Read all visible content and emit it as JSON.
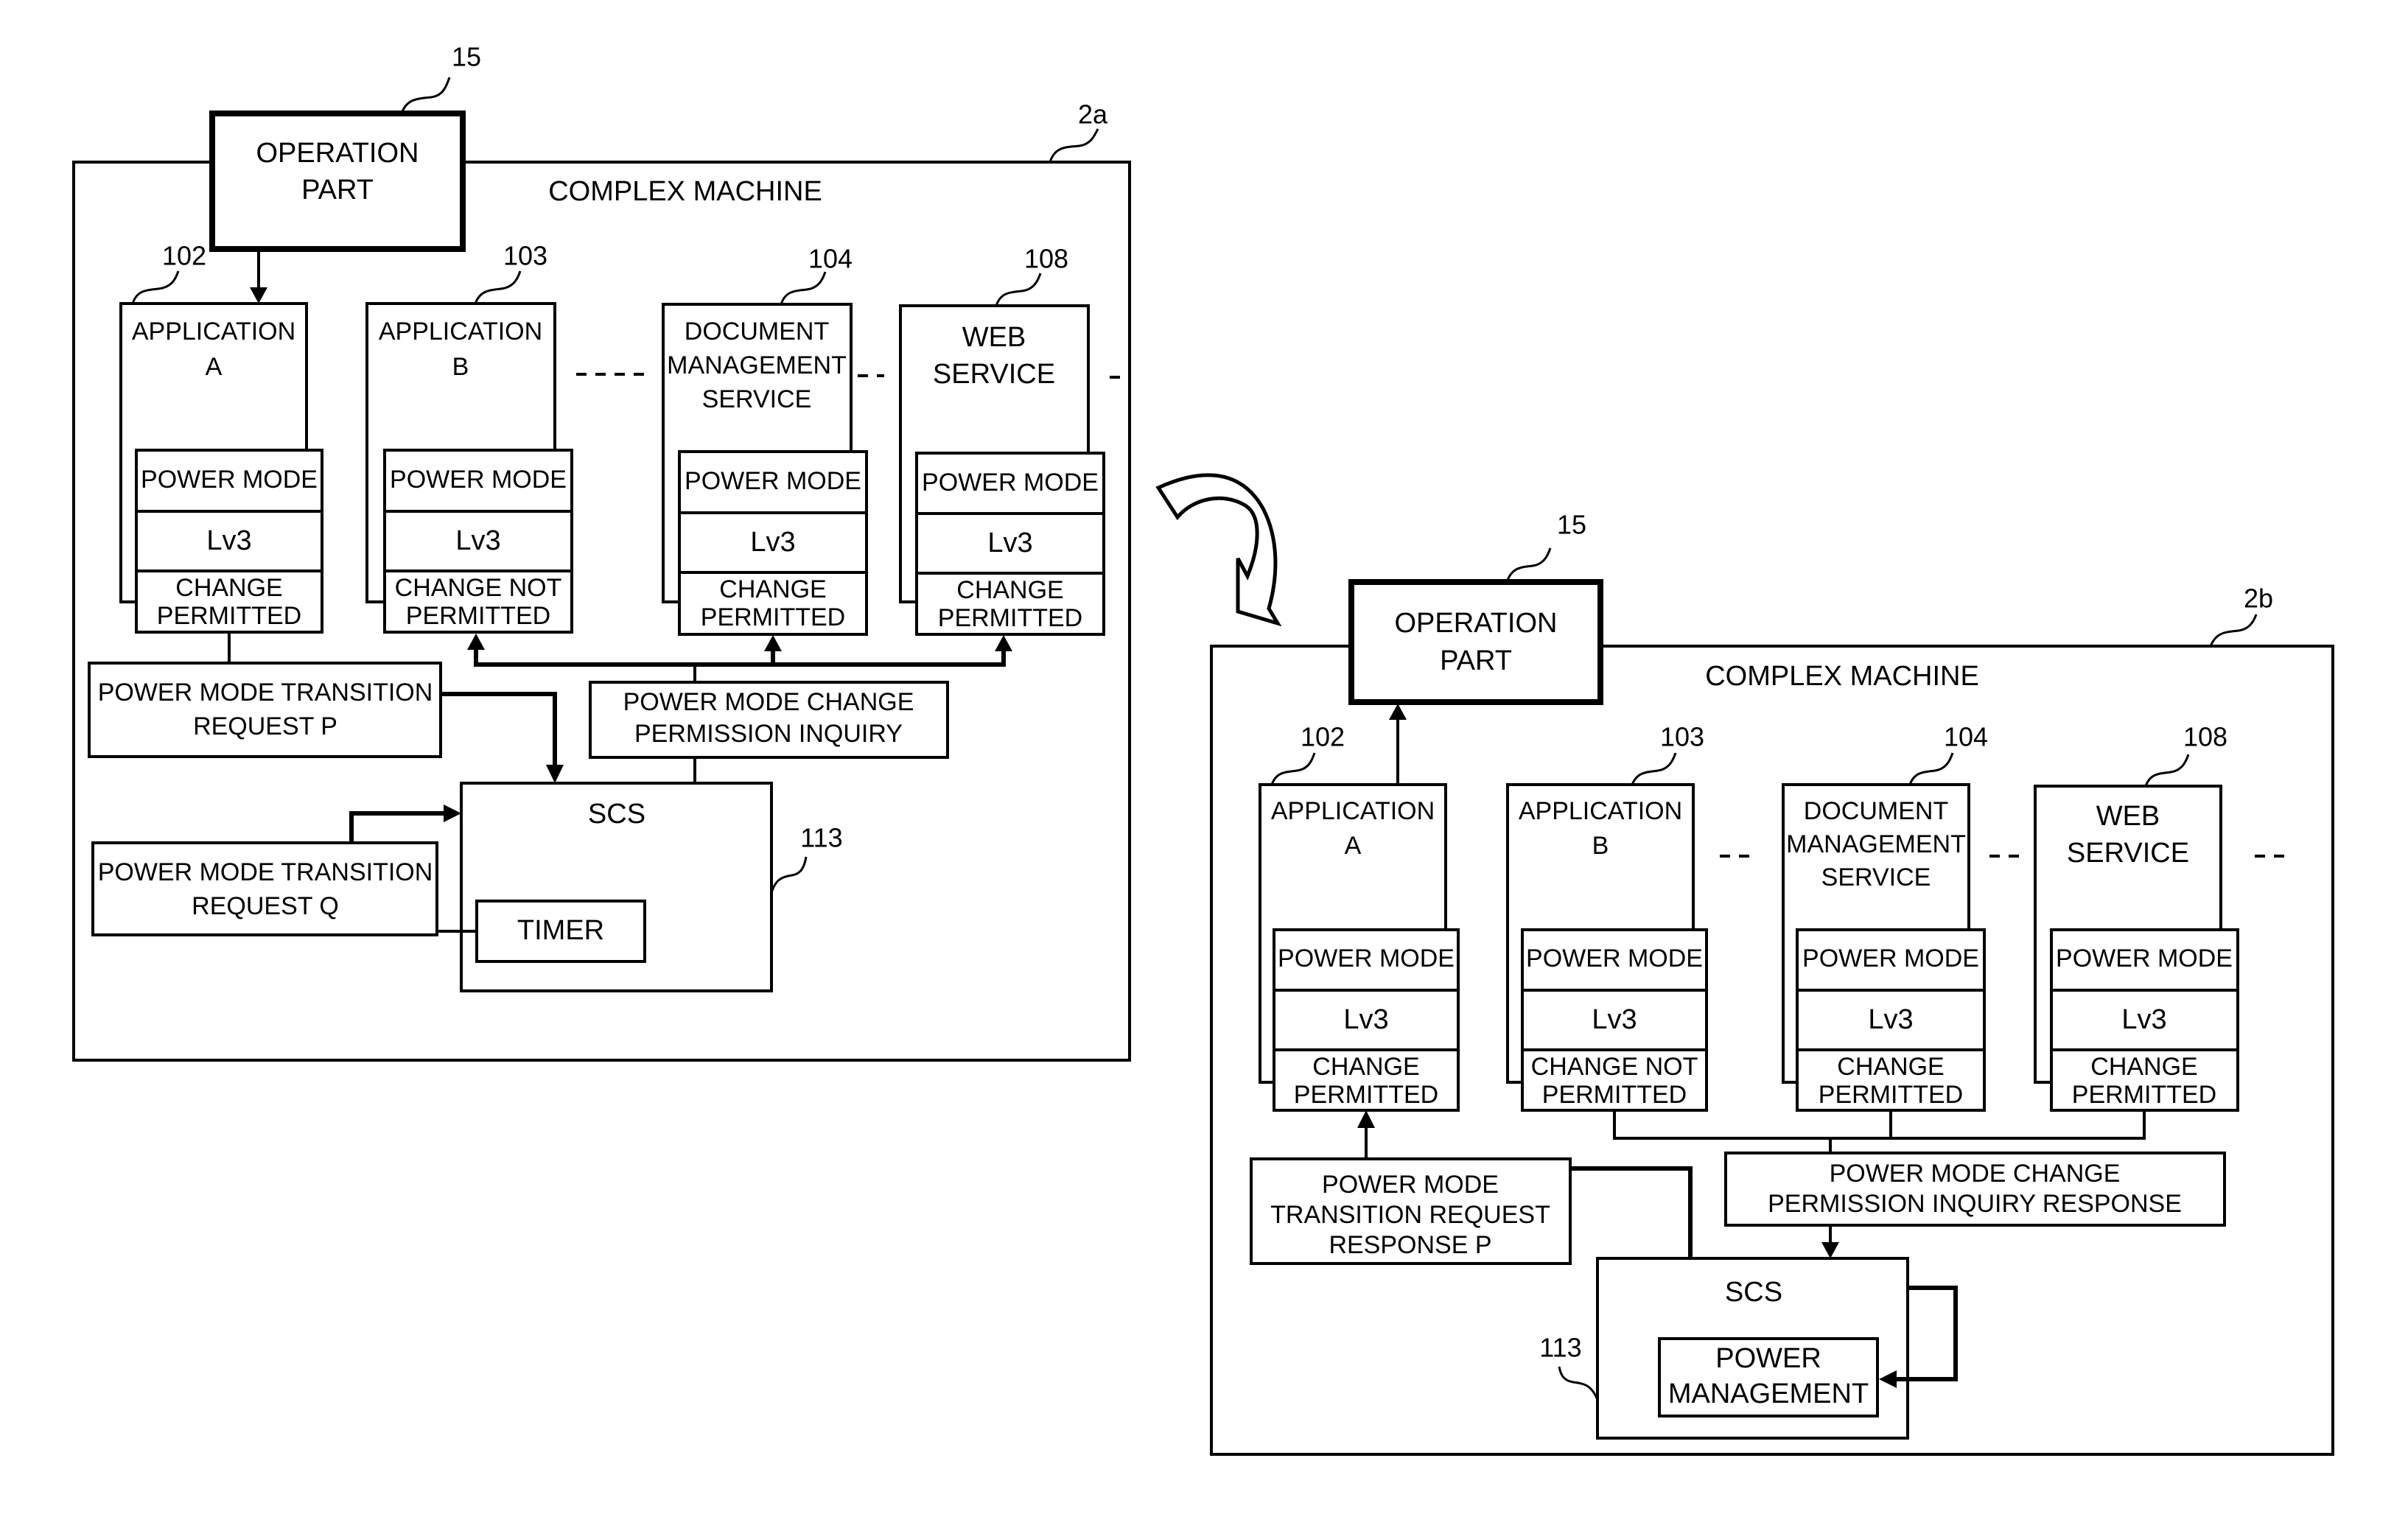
{
  "panel_a": {
    "ref_machine": "2a",
    "machine_label": "COMPLEX MACHINE",
    "operation_part": {
      "ref": "15",
      "line1": "OPERATION",
      "line2": "PART"
    },
    "modules": [
      {
        "ref": "102",
        "name_lines": [
          "APPLICATION",
          "A"
        ],
        "power_mode_label": "POWER MODE",
        "level": "Lv3",
        "status_lines": [
          "CHANGE",
          "PERMITTED"
        ]
      },
      {
        "ref": "103",
        "name_lines": [
          "APPLICATION",
          "B"
        ],
        "power_mode_label": "POWER MODE",
        "level": "Lv3",
        "status_lines": [
          "CHANGE NOT",
          "PERMITTED"
        ]
      },
      {
        "ref": "104",
        "name_lines": [
          "DOCUMENT",
          "MANAGEMENT",
          "SERVICE"
        ],
        "power_mode_label": "POWER MODE",
        "level": "Lv3",
        "status_lines": [
          "CHANGE",
          "PERMITTED"
        ]
      },
      {
        "ref": "108",
        "name_lines": [
          "WEB",
          "SERVICE"
        ],
        "power_mode_label": "POWER MODE",
        "level": "Lv3",
        "status_lines": [
          "CHANGE",
          "PERMITTED"
        ]
      }
    ],
    "request_p": {
      "line1": "POWER MODE TRANSITION",
      "line2": "REQUEST P"
    },
    "request_q": {
      "line1": "POWER MODE TRANSITION",
      "line2": "REQUEST Q"
    },
    "inquiry": {
      "line1": "POWER MODE CHANGE",
      "line2": "PERMISSION INQUIRY"
    },
    "scs": {
      "ref": "113",
      "label": "SCS",
      "inner_label": "TIMER"
    }
  },
  "panel_b": {
    "ref_machine": "2b",
    "machine_label": "COMPLEX MACHINE",
    "operation_part": {
      "ref": "15",
      "line1": "OPERATION",
      "line2": "PART"
    },
    "modules": [
      {
        "ref": "102",
        "name_lines": [
          "APPLICATION",
          "A"
        ],
        "power_mode_label": "POWER MODE",
        "level": "Lv3",
        "status_lines": [
          "CHANGE",
          "PERMITTED"
        ]
      },
      {
        "ref": "103",
        "name_lines": [
          "APPLICATION",
          "B"
        ],
        "power_mode_label": "POWER MODE",
        "level": "Lv3",
        "status_lines": [
          "CHANGE NOT",
          "PERMITTED"
        ]
      },
      {
        "ref": "104",
        "name_lines": [
          "DOCUMENT",
          "MANAGEMENT",
          "SERVICE"
        ],
        "power_mode_label": "POWER MODE",
        "level": "Lv3",
        "status_lines": [
          "CHANGE",
          "PERMITTED"
        ]
      },
      {
        "ref": "108",
        "name_lines": [
          "WEB",
          "SERVICE"
        ],
        "power_mode_label": "POWER MODE",
        "level": "Lv3",
        "status_lines": [
          "CHANGE",
          "PERMITTED"
        ]
      }
    ],
    "response_p": {
      "line1": "POWER MODE",
      "line2": "TRANSITION REQUEST",
      "line3": "RESPONSE P"
    },
    "inquiry_response": {
      "line1": "POWER MODE CHANGE",
      "line2": "PERMISSION INQUIRY RESPONSE"
    },
    "scs": {
      "ref": "113",
      "label": "SCS",
      "inner_line1": "POWER",
      "inner_line2": "MANAGEMENT"
    }
  },
  "transition_arrow": {
    "icon": "curved-arrow-icon"
  }
}
